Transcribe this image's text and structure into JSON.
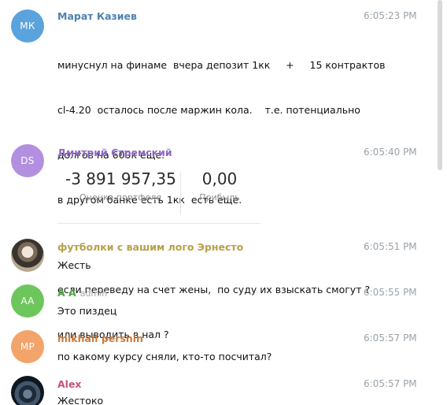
{
  "messages": [
    {
      "initials": "МК",
      "avatar_color": "#5aa3dd",
      "name": "Марат Казиев",
      "name_color": "#4f81b0",
      "time": "6:05:23 PM",
      "lines": [
        "минуснул на финаме  вчера депозит 1кк     +     15 контрактов",
        "cl-4.20  осталось после маржин кола.    т.е. потенциально",
        "долгов на 600к еще.",
        "в другом банке есть 1кк  есть еще.",
        "",
        "если переведу на счет жены,  по суду их взыскать смогут ?",
        "или выводить в нал ?"
      ]
    },
    {
      "initials": "DS",
      "avatar_color": "#b38fe0",
      "name": "Дмитрий Стремский",
      "name_color": "#8e68c4",
      "time": "6:05:40 PM",
      "portfolio": {
        "value": "-3 891 957,35",
        "value_label": "Оценка портфеля",
        "profit": "0,00",
        "profit_label": "Прибыль"
      }
    },
    {
      "avatar_icon": "user-photo-icon",
      "name": "футболки с вашим лого Эрнесто",
      "name_color": "#b8a04a",
      "time": "6:05:51 PM",
      "text": "Жесть"
    },
    {
      "initials": "AA",
      "avatar_color": "#6cc65c",
      "name": "A A",
      "role": "admin",
      "name_color": "#4ea442",
      "time": "6:05:55 PM",
      "text": "Это пиздец"
    },
    {
      "initials": "MP",
      "avatar_color": "#f3a46a",
      "name": "mikhail pershin",
      "name_color": "#c97a3a",
      "time": "6:05:57 PM",
      "text": "по какому курсу сняли, кто-то посчитал?"
    },
    {
      "avatar_icon": "car-dashboard-photo-icon",
      "name": "Alex",
      "name_color": "#c05575",
      "time": "6:05:57 PM",
      "text": "Жестоко"
    }
  ]
}
